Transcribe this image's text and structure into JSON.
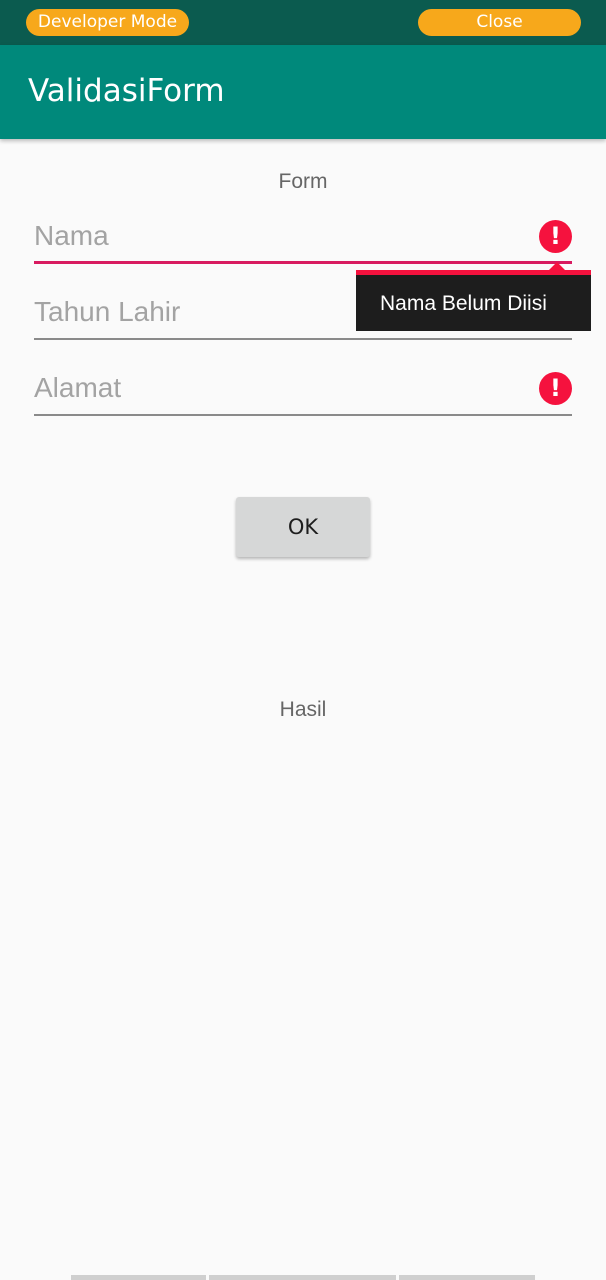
{
  "overlay": {
    "developer_mode_label": "Developer Mode",
    "close_label": "Close"
  },
  "app_bar": {
    "title": "ValidasiForm"
  },
  "form": {
    "heading": "Form",
    "fields": [
      {
        "placeholder": "Nama",
        "error": true,
        "focused": true
      },
      {
        "placeholder": "Tahun Lahir",
        "error": true,
        "focused": false
      },
      {
        "placeholder": "Alamat",
        "error": true,
        "focused": false
      }
    ],
    "error_icon_glyph": "!",
    "error_message": "Nama Belum Diisi",
    "ok_label": "OK"
  },
  "result": {
    "label": "Hasil"
  },
  "colors": {
    "accent": "#00897b",
    "status_bar": "#0b5b4f",
    "pill": "#f7a81b",
    "error": "#f5123e",
    "focus_line": "#d81b60"
  }
}
